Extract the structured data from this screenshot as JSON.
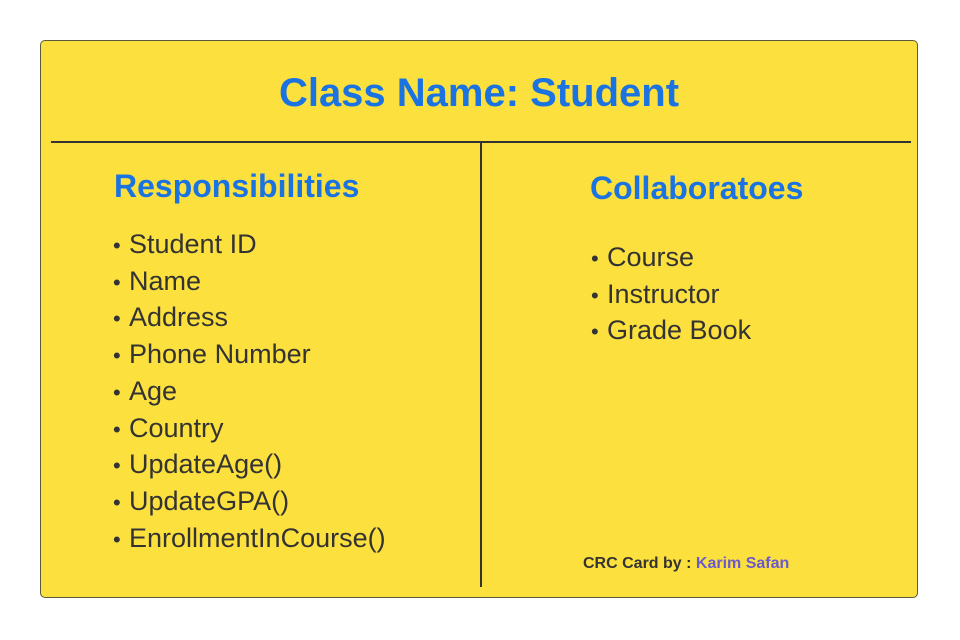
{
  "card": {
    "title": "Class Name: Student",
    "responsibilities": {
      "heading": "Responsibilities",
      "items": [
        "Student ID",
        "Name",
        "Address",
        "Phone Number",
        "Age",
        "Country",
        "UpdateAge()",
        "UpdateGPA()",
        "EnrollmentInCourse()"
      ]
    },
    "collaborators": {
      "heading": "Collaboratoes",
      "items": [
        "Course",
        "Instructor",
        "Grade Book"
      ]
    },
    "credit": {
      "prefix": "CRC Card by : ",
      "author": "Karim Safan"
    }
  },
  "colors": {
    "card_background": "#FCE03E",
    "heading": "#1A73E0",
    "text": "#333333",
    "author": "#6A5ACD"
  }
}
